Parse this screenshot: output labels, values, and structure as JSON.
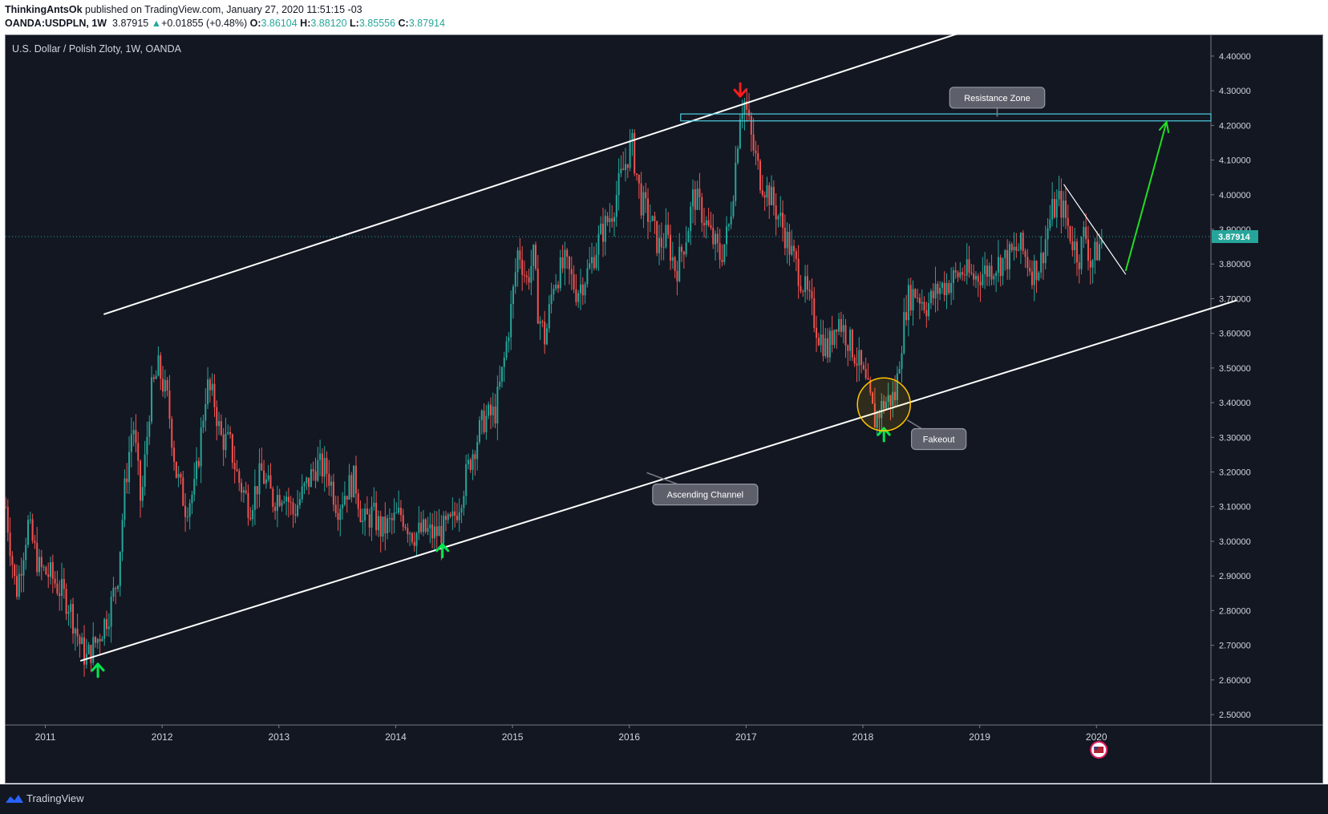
{
  "header": {
    "publisher": "ThinkingAntsOk",
    "published_text": "published on TradingView.com, January 27, 2020 11:51:15 -03",
    "symbol": "OANDA:USDPLN, 1W",
    "last": "3.87915",
    "change": "+0.01855 (+0.48%)",
    "open_label": "O:",
    "open": "3.86104",
    "high_label": "H:",
    "high": "3.88120",
    "low_label": "L:",
    "low": "3.85556",
    "close_label": "C:",
    "close": "3.87914"
  },
  "footer": {
    "brand": "TradingView"
  },
  "colors": {
    "background": "#131722",
    "up": "#26a69a",
    "down": "#ef5350",
    "channel": "#ffffff",
    "zone": "#4dd0e1",
    "arrow_up": "#00e64d",
    "arrow_down": "#ff1a1a",
    "fakeout_circle": "#ffc400",
    "projection": "#22dd22",
    "current_price": "#26a69a"
  },
  "chart_data": {
    "type": "candlestick",
    "title": "U.S. Dollar / Polish Zloty, 1W, OANDA",
    "y_axis": {
      "ticks": [
        "2.50000",
        "2.60000",
        "2.70000",
        "2.80000",
        "2.90000",
        "3.00000",
        "3.10000",
        "3.20000",
        "3.30000",
        "3.40000",
        "3.50000",
        "3.60000",
        "3.70000",
        "3.80000",
        "3.90000",
        "4.00000",
        "4.10000",
        "4.20000",
        "4.30000",
        "4.40000"
      ],
      "range": [
        2.47,
        4.46
      ],
      "position": "right"
    },
    "x_axis": {
      "ticks": [
        "2011",
        "2012",
        "2013",
        "2014",
        "2015",
        "2016",
        "2017",
        "2018",
        "2019",
        "2020"
      ],
      "range": [
        2010.66,
        2020.98
      ]
    },
    "current_price": "3.87914",
    "price_path": [
      [
        2010.66,
        3.1
      ],
      [
        2010.75,
        2.85
      ],
      [
        2010.85,
        3.05
      ],
      [
        2010.95,
        2.92
      ],
      [
        2011.05,
        2.9
      ],
      [
        2011.2,
        2.82
      ],
      [
        2011.3,
        2.7
      ],
      [
        2011.35,
        2.66
      ],
      [
        2011.45,
        2.72
      ],
      [
        2011.55,
        2.8
      ],
      [
        2011.62,
        2.9
      ],
      [
        2011.68,
        3.15
      ],
      [
        2011.75,
        3.35
      ],
      [
        2011.82,
        3.1
      ],
      [
        2011.9,
        3.42
      ],
      [
        2011.97,
        3.5
      ],
      [
        2012.05,
        3.4
      ],
      [
        2012.12,
        3.2
      ],
      [
        2012.2,
        3.1
      ],
      [
        2012.28,
        3.15
      ],
      [
        2012.38,
        3.45
      ],
      [
        2012.45,
        3.4
      ],
      [
        2012.5,
        3.3
      ],
      [
        2012.58,
        3.28
      ],
      [
        2012.65,
        3.18
      ],
      [
        2012.75,
        3.1
      ],
      [
        2012.85,
        3.2
      ],
      [
        2012.95,
        3.12
      ],
      [
        2013.05,
        3.15
      ],
      [
        2013.12,
        3.08
      ],
      [
        2013.22,
        3.15
      ],
      [
        2013.32,
        3.22
      ],
      [
        2013.42,
        3.2
      ],
      [
        2013.5,
        3.1
      ],
      [
        2013.58,
        3.15
      ],
      [
        2013.65,
        3.18
      ],
      [
        2013.72,
        3.05
      ],
      [
        2013.8,
        3.08
      ],
      [
        2013.88,
        3.03
      ],
      [
        2013.95,
        3.05
      ],
      [
        2014.05,
        3.08
      ],
      [
        2014.15,
        3.02
      ],
      [
        2014.25,
        3.03
      ],
      [
        2014.32,
        3.02
      ],
      [
        2014.4,
        3.03
      ],
      [
        2014.48,
        3.05
      ],
      [
        2014.55,
        3.12
      ],
      [
        2014.65,
        3.25
      ],
      [
        2014.75,
        3.35
      ],
      [
        2014.85,
        3.37
      ],
      [
        2014.92,
        3.5
      ],
      [
        2015.0,
        3.7
      ],
      [
        2015.05,
        3.85
      ],
      [
        2015.12,
        3.75
      ],
      [
        2015.18,
        3.82
      ],
      [
        2015.22,
        3.66
      ],
      [
        2015.28,
        3.58
      ],
      [
        2015.35,
        3.75
      ],
      [
        2015.45,
        3.8
      ],
      [
        2015.55,
        3.72
      ],
      [
        2015.65,
        3.78
      ],
      [
        2015.75,
        3.88
      ],
      [
        2015.85,
        3.95
      ],
      [
        2015.93,
        4.05
      ],
      [
        2016.02,
        4.15
      ],
      [
        2016.1,
        3.98
      ],
      [
        2016.18,
        3.93
      ],
      [
        2016.25,
        3.85
      ],
      [
        2016.32,
        3.88
      ],
      [
        2016.4,
        3.78
      ],
      [
        2016.5,
        3.9
      ],
      [
        2016.55,
        4.0
      ],
      [
        2016.62,
        3.95
      ],
      [
        2016.7,
        3.88
      ],
      [
        2016.78,
        3.82
      ],
      [
        2016.85,
        3.9
      ],
      [
        2016.9,
        4.05
      ],
      [
        2016.95,
        4.25
      ],
      [
        2016.99,
        4.27
      ],
      [
        2017.05,
        4.15
      ],
      [
        2017.12,
        4.05
      ],
      [
        2017.2,
        4.0
      ],
      [
        2017.3,
        3.92
      ],
      [
        2017.4,
        3.82
      ],
      [
        2017.48,
        3.75
      ],
      [
        2017.55,
        3.68
      ],
      [
        2017.62,
        3.6
      ],
      [
        2017.7,
        3.55
      ],
      [
        2017.78,
        3.65
      ],
      [
        2017.85,
        3.6
      ],
      [
        2017.92,
        3.55
      ],
      [
        2017.98,
        3.5
      ],
      [
        2018.05,
        3.42
      ],
      [
        2018.1,
        3.35
      ],
      [
        2018.18,
        3.4
      ],
      [
        2018.28,
        3.42
      ],
      [
        2018.32,
        3.55
      ],
      [
        2018.38,
        3.7
      ],
      [
        2018.45,
        3.72
      ],
      [
        2018.55,
        3.68
      ],
      [
        2018.65,
        3.73
      ],
      [
        2018.75,
        3.75
      ],
      [
        2018.85,
        3.78
      ],
      [
        2018.95,
        3.76
      ],
      [
        2019.05,
        3.78
      ],
      [
        2019.15,
        3.8
      ],
      [
        2019.25,
        3.82
      ],
      [
        2019.35,
        3.85
      ],
      [
        2019.45,
        3.78
      ],
      [
        2019.52,
        3.8
      ],
      [
        2019.58,
        3.9
      ],
      [
        2019.62,
        3.95
      ],
      [
        2019.68,
        3.98
      ],
      [
        2019.72,
        3.95
      ],
      [
        2019.78,
        3.88
      ],
      [
        2019.85,
        3.82
      ],
      [
        2019.9,
        3.9
      ],
      [
        2019.95,
        3.8
      ],
      [
        2020.02,
        3.85
      ],
      [
        2020.06,
        3.879
      ]
    ],
    "channel": {
      "upper": [
        [
          2011.5,
          3.655
        ],
        [
          2021.0,
          4.707
        ]
      ],
      "lower": [
        [
          2011.3,
          2.655
        ],
        [
          2021.2,
          3.695
        ]
      ]
    },
    "resistance_zone": {
      "x": [
        2016.44,
        2020.98
      ],
      "y": [
        4.213,
        4.233
      ]
    },
    "local_trendline": [
      [
        2019.72,
        4.03
      ],
      [
        2020.25,
        3.77
      ]
    ],
    "projection_arrow": [
      [
        2020.25,
        3.78
      ],
      [
        2020.6,
        4.21
      ]
    ],
    "annotations": [
      {
        "text": "Resistance Zone",
        "x": 2019.15,
        "y": 4.28,
        "pointer": [
          2019.15,
          4.225
        ]
      },
      {
        "text": "Ascending Channel",
        "x": 2016.65,
        "y": 3.135,
        "pointer": [
          2016.15,
          3.198
        ]
      },
      {
        "text": "Fakeout",
        "x": 2018.65,
        "y": 3.295,
        "pointer": [
          2018.38,
          3.35
        ]
      }
    ],
    "markers": [
      {
        "type": "arrow-up",
        "x": 2011.45,
        "y": 2.63
      },
      {
        "type": "arrow-up",
        "x": 2014.4,
        "y": 2.975
      },
      {
        "type": "arrow-down",
        "x": 2016.95,
        "y": 4.3
      },
      {
        "type": "arrow-up",
        "x": 2018.18,
        "y": 3.31
      },
      {
        "type": "circle",
        "x": 2018.18,
        "y": 3.395
      }
    ]
  }
}
